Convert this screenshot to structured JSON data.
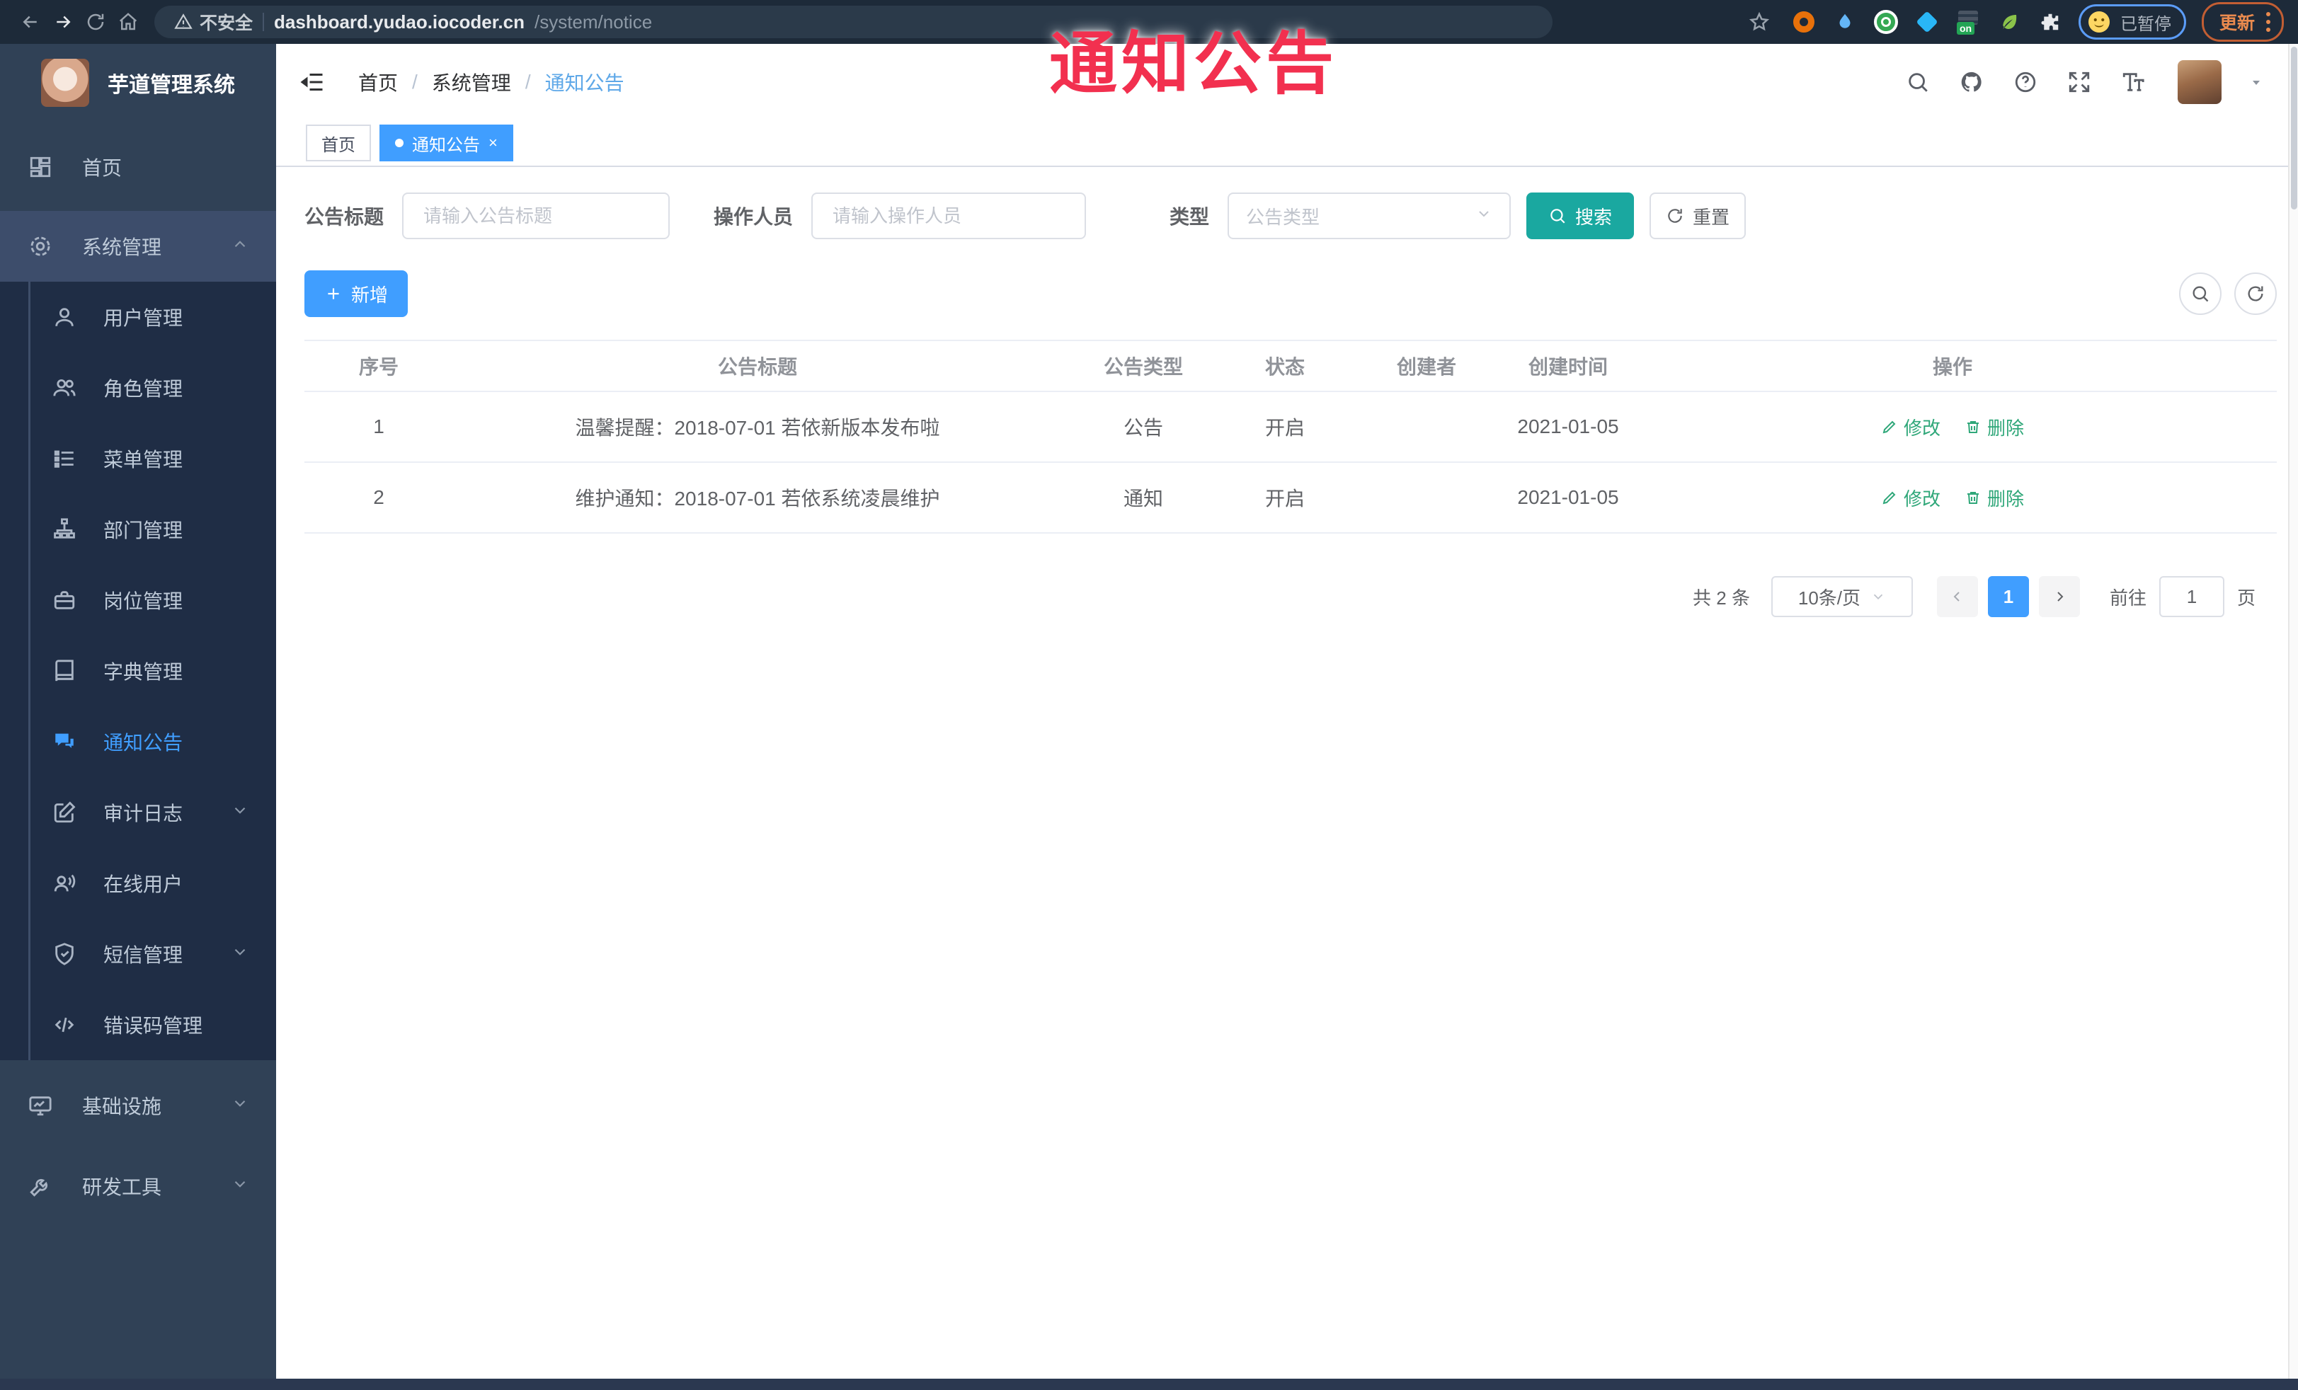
{
  "browser": {
    "insecure_label": "不安全",
    "url_host": "dashboard.yudao.iocoder.cn",
    "url_path": "/system/notice",
    "ext_on_badge": "on",
    "paused_label": "已暂停",
    "update_label": "更新"
  },
  "overlay": {
    "text": "通知公告",
    "color": "#F2304F"
  },
  "sidebar": {
    "logo_title": "芋道管理系统",
    "home": "首页",
    "system": "系统管理",
    "submenu": [
      "用户管理",
      "角色管理",
      "菜单管理",
      "部门管理",
      "岗位管理",
      "字典管理",
      "通知公告",
      "审计日志",
      "在线用户",
      "短信管理",
      "错误码管理"
    ],
    "active_item": "通知公告",
    "infra": "基础设施",
    "devtools": "研发工具"
  },
  "breadcrumb": {
    "items": [
      "首页",
      "系统管理",
      "通知公告"
    ]
  },
  "tabs": [
    {
      "label": "首页",
      "active": false
    },
    {
      "label": "通知公告",
      "active": true,
      "close": "×"
    }
  ],
  "filters": {
    "title_label": "公告标题",
    "title_placeholder": "请输入公告标题",
    "operator_label": "操作人员",
    "operator_placeholder": "请输入操作人员",
    "type_label": "类型",
    "type_placeholder": "公告类型",
    "search_label": "搜索",
    "reset_label": "重置"
  },
  "toolbar": {
    "add_label": "新增"
  },
  "table": {
    "columns": [
      "序号",
      "公告标题",
      "公告类型",
      "状态",
      "创建者",
      "创建时间",
      "操作"
    ],
    "rows": [
      {
        "no": "1",
        "title": "温馨提醒：2018-07-01 若依新版本发布啦",
        "type": "公告",
        "status": "开启",
        "creator": "",
        "time": "2021-01-05"
      },
      {
        "no": "2",
        "title": "维护通知：2018-07-01 若依系统凌晨维护",
        "type": "通知",
        "status": "开启",
        "creator": "",
        "time": "2021-01-05"
      }
    ],
    "action_edit": "修改",
    "action_delete": "删除"
  },
  "pagination": {
    "total": "共 2 条",
    "page_size": "10条/页",
    "current_page": "1",
    "goto_label": "前往",
    "goto_value": "1",
    "goto_unit": "页"
  },
  "colors": {
    "primary_blue": "#409EFF",
    "search_teal": "#1AA8A0",
    "action_green": "#2FA779",
    "annotation_red": "#F2304F",
    "sidebar_bg": "#304156",
    "submenu_bg": "#1F2D45",
    "toolbar_bg": "#1D2A39"
  }
}
